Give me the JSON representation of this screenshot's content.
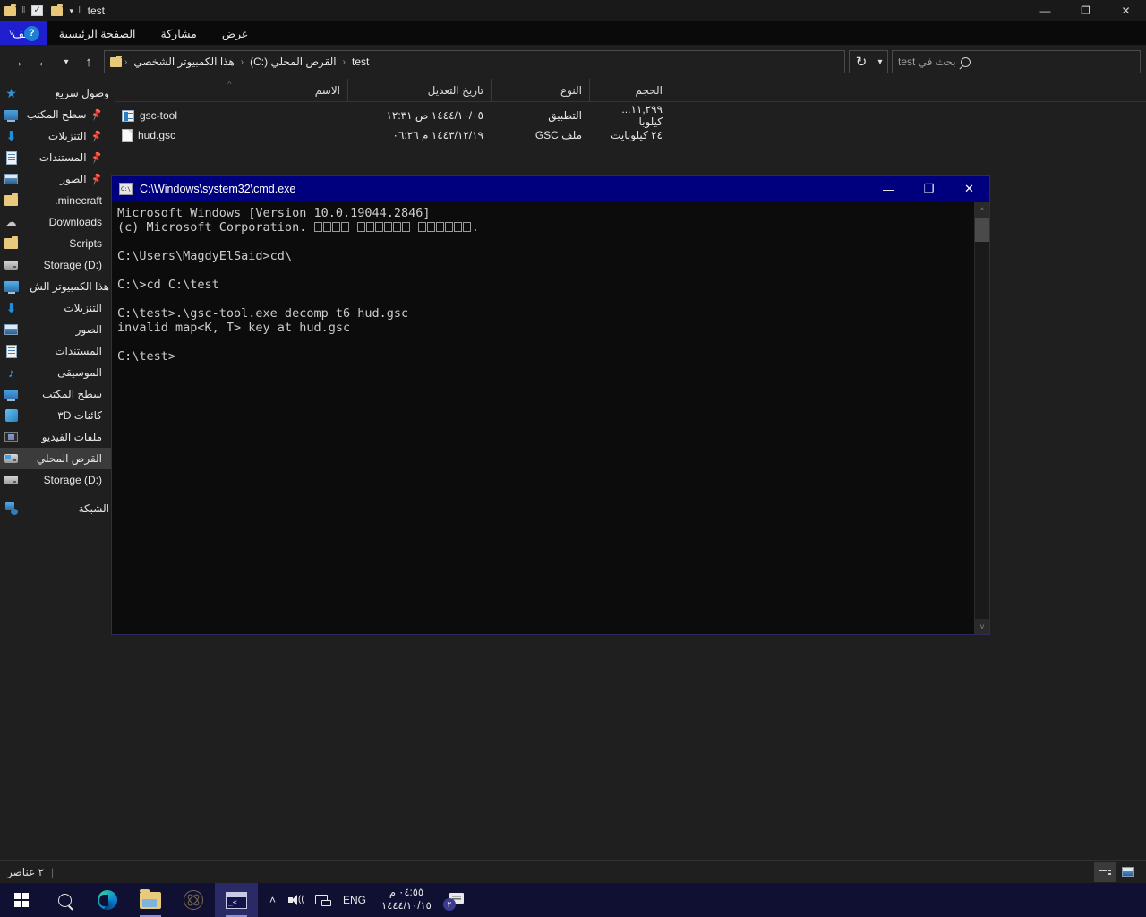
{
  "explorer": {
    "title": "test",
    "quick_access_toolbar": {
      "new_folder_icon": "folder-icon",
      "properties_icon": "checkbox-icon",
      "customize_caret": "chevron-down-icon"
    },
    "window_controls": {
      "minimize": "—",
      "restore": "❐",
      "close": "✕"
    },
    "ribbon": {
      "help_label": "?",
      "expand_caret": "˅",
      "tabs": [
        {
          "label": "ملف",
          "active": true
        },
        {
          "label": "الصفحة الرئيسية",
          "active": false
        },
        {
          "label": "مشاركة",
          "active": false
        },
        {
          "label": "عرض",
          "active": false
        }
      ]
    },
    "navbar": {
      "forward_icon": "arrow-right-icon",
      "back_icon": "arrow-left-icon",
      "recent_caret": "chevron-down-icon",
      "up_icon": "arrow-up-icon",
      "breadcrumbs": [
        "هذا الكمبيوتر الشخصي",
        "القرص المحلي (:C)",
        "test"
      ],
      "separator": "‹",
      "refresh_icon": "refresh-icon",
      "refresh_caret": "chevron-down-icon",
      "search_placeholder": "بحث في test"
    },
    "sidebar": {
      "groups": [
        {
          "header": {
            "label": "وصول سريع",
            "icon": "star-icon"
          },
          "items": [
            {
              "label": "سطح المكتب",
              "icon": "monitor-icon",
              "pinned": true
            },
            {
              "label": "التنزيلات",
              "icon": "download-icon",
              "pinned": true
            },
            {
              "label": "المستندات",
              "icon": "documents-icon",
              "pinned": true
            },
            {
              "label": "الصور",
              "icon": "pictures-icon",
              "pinned": true
            },
            {
              "label": "minecraft.",
              "icon": "folder-icon",
              "pinned": false
            },
            {
              "label": "Downloads",
              "icon": "cloud-icon",
              "pinned": false
            },
            {
              "label": "Scripts",
              "icon": "folder-icon",
              "pinned": false
            },
            {
              "label": "Storage (D:)",
              "icon": "drive-icon",
              "pinned": false
            }
          ]
        },
        {
          "header": {
            "label": "هذا الكمبيوتر الش",
            "icon": "pc-icon"
          },
          "items": [
            {
              "label": "التنزيلات",
              "icon": "download-icon",
              "pinned": false
            },
            {
              "label": "الصور",
              "icon": "pictures-icon",
              "pinned": false
            },
            {
              "label": "المستندات",
              "icon": "documents-icon",
              "pinned": false
            },
            {
              "label": "الموسيقى",
              "icon": "music-icon",
              "pinned": false
            },
            {
              "label": "سطح المكتب",
              "icon": "monitor-icon",
              "pinned": false
            },
            {
              "label": "كائنات ٣D",
              "icon": "3d-objects-icon",
              "pinned": false
            },
            {
              "label": "ملفات الفيديو",
              "icon": "videos-icon",
              "pinned": false
            },
            {
              "label": "القرص المحلي",
              "icon": "windows-drive-icon",
              "pinned": false,
              "selected": true
            },
            {
              "label": "Storage (D:)",
              "icon": "drive-icon",
              "pinned": false
            }
          ]
        },
        {
          "header": {
            "label": "الشبكة",
            "icon": "network-icon"
          },
          "items": []
        }
      ]
    },
    "filelist": {
      "columns": [
        {
          "key": "name",
          "label": "الاسم",
          "sorted": true,
          "sort_caret": "^"
        },
        {
          "key": "date",
          "label": "تاريخ التعديل",
          "sorted": false
        },
        {
          "key": "type",
          "label": "النوع",
          "sorted": false
        },
        {
          "key": "size",
          "label": "الحجم",
          "sorted": false
        }
      ],
      "rows": [
        {
          "name": "gsc-tool",
          "icon": "application-icon",
          "date": "١٤٤٤/١٠/٠٥ ص ١٢:٣١",
          "type": "التطبيق",
          "size": "١١,٢٩٩... كيلوبا"
        },
        {
          "name": "hud.gsc",
          "icon": "gsc-file-icon",
          "date": "١٤٤٣/١٢/١٩ م ٠٦:٢٦",
          "type": "ملف GSC",
          "size": "٢٤ كيلوبايت"
        }
      ]
    },
    "statusbar": {
      "item_count": "٢ عناصر",
      "separator": "|",
      "view_details_icon": "details-view-icon",
      "view_list_icon": "list-view-icon"
    }
  },
  "cmd": {
    "title": "C:\\Windows\\system32\\cmd.exe",
    "icon": "cmd-icon",
    "window_controls": {
      "minimize": "—",
      "maximize": "❐",
      "close": "✕"
    },
    "lines": [
      "Microsoft Windows [Version 10.0.19044.2846]",
      "",
      "C:\\Users\\MagdyElSaid>cd\\",
      "",
      "C:\\>cd C:\\test",
      "",
      "C:\\test>.\\gsc-tool.exe decomp t6 hud.gsc",
      "invalid map<K, T> key at hud.gsc",
      "",
      "C:\\test>"
    ],
    "copyright_prefix": "(c) Microsoft Corporation. ",
    "copyright_boxes": [
      4,
      6,
      6
    ],
    "copyright_suffix": ".",
    "scrollbar": {
      "up_arrow": "^",
      "down_arrow": "˅"
    }
  },
  "taskbar": {
    "start_icon": "windows-logo-icon",
    "search_icon": "search-icon",
    "items": [
      {
        "name": "edge",
        "icon": "edge-icon",
        "running": false
      },
      {
        "name": "file-explorer",
        "icon": "file-explorer-icon",
        "running": true
      },
      {
        "name": "gsc-tool",
        "icon": "atom-icon",
        "running": false
      },
      {
        "name": "cmd",
        "icon": "cmd-taskbar-icon",
        "running": true,
        "active": true
      }
    ],
    "tray": {
      "overflow_caret": "˄",
      "volume_icon": "speaker-icon",
      "network_icon": "network-icon",
      "language": "ENG",
      "time": "٠٤:٥٥ م",
      "date": "١٤٤٤/١٠/١٥",
      "notifications_icon": "chat-icon",
      "notification_count": "٢"
    }
  }
}
